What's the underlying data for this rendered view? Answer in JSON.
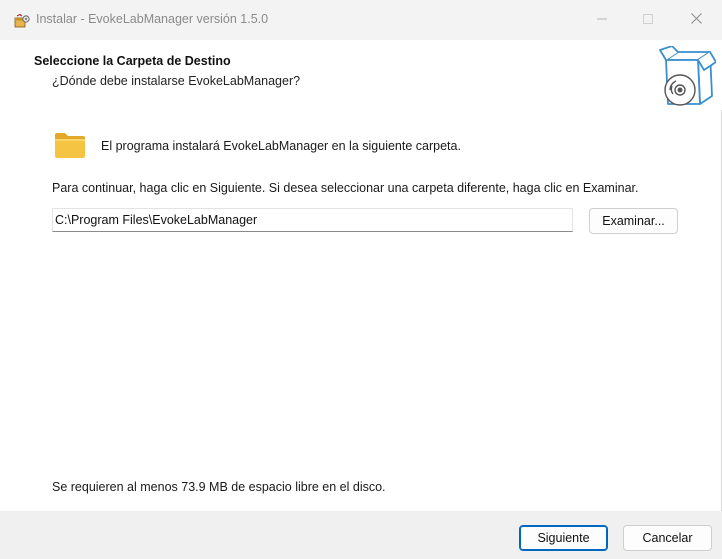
{
  "window": {
    "title": "Instalar - EvokeLabManager versión 1.5.0"
  },
  "header": {
    "title": "Seleccione la Carpeta de Destino",
    "subtitle": "¿Dónde debe instalarse EvokeLabManager?"
  },
  "body": {
    "info": "El programa instalará EvokeLabManager en la siguiente carpeta.",
    "instructions": "Para continuar, haga clic en Siguiente. Si desea seleccionar una carpeta diferente, haga clic en Examinar.",
    "path_value": "C:\\Program Files\\EvokeLabManager",
    "browse_label": "Examinar...",
    "disk_space": "Se requieren al menos 73.9 MB de espacio libre en el disco."
  },
  "footer": {
    "next_label": "Siguiente",
    "cancel_label": "Cancelar"
  },
  "icons": {
    "app": "installer-app-icon",
    "header": "box-with-disc-icon",
    "folder": "folder-icon",
    "minimize": "minimize-icon",
    "maximize": "maximize-icon",
    "close": "close-icon"
  },
  "colors": {
    "titlebar_bg": "#f3f3f3",
    "footer_bg": "#f0f0f0",
    "accent": "#0067c0",
    "folder": "#f6c443"
  }
}
